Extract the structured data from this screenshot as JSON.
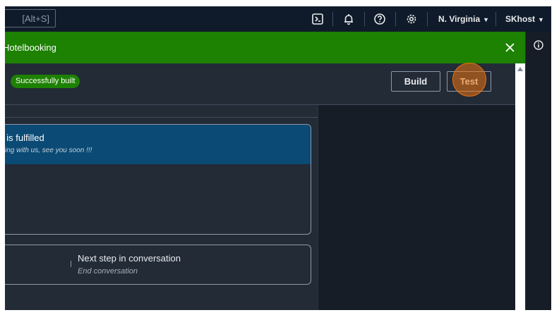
{
  "topnav": {
    "search_shortcut": "[Alt+S]",
    "icons": [
      "cloudshell-icon",
      "bell-icon",
      "help-icon",
      "gear-icon"
    ],
    "region": "N. Virginia",
    "account": "SKhost"
  },
  "flash": {
    "title": "Hotelbooking",
    "color": "#1d8102"
  },
  "toolbar": {
    "status": "Successfully built",
    "build_label": "Build",
    "test_label": "Test"
  },
  "fulfillment_card": {
    "title": "t is fulfilled",
    "message": "king with us, see you soon !!!"
  },
  "next_step_card": {
    "label": "Next step in conversation",
    "value": "End conversation"
  },
  "colors": {
    "topnav": "#0f1b2a",
    "panel": "#232b37",
    "card_header": "#0a4a74",
    "highlight": "#ec7211"
  }
}
